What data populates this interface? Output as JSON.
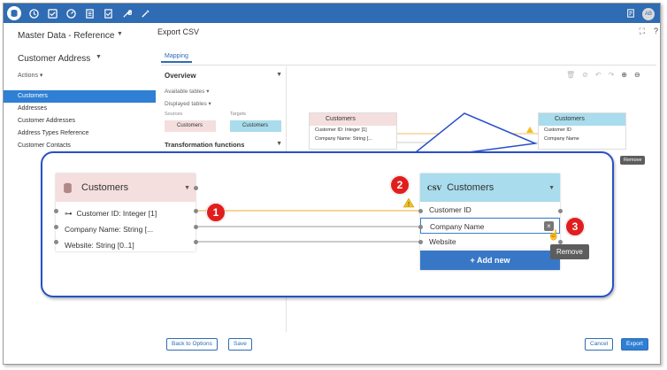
{
  "app": {
    "header_title": "Master Data - Reference",
    "entity_title": "Customer Address",
    "actions_label": "Actions",
    "page_title": "Export CSV",
    "avatar_initials": "AB"
  },
  "sidebar": {
    "items": [
      {
        "label": "Customers",
        "selected": true
      },
      {
        "label": "Addresses",
        "selected": false
      },
      {
        "label": "Customer Addresses",
        "selected": false
      },
      {
        "label": "Address Types Reference",
        "selected": false
      },
      {
        "label": "Customer Contacts",
        "selected": false
      }
    ]
  },
  "tabs": [
    {
      "label": "Mapping"
    }
  ],
  "overview": {
    "title": "Overview",
    "available_tables": "Available tables",
    "displayed_tables": "Displayed tables",
    "sources_label": "Sources",
    "targets_label": "Targets",
    "source_chip": "Customers",
    "target_chip": "Customers",
    "transformation_functions": "Transformation functions"
  },
  "diagram": {
    "source": {
      "title": "Customers",
      "rows": [
        "Customer ID: Integer [1]",
        "Company Name: String [...",
        "Website: String [0..1]"
      ]
    },
    "target": {
      "badge": "CSV",
      "title": "Customers",
      "rows": [
        "Customer ID",
        "Company Name",
        "Website"
      ],
      "add_new": "+ Add new"
    },
    "tooltip": "Remove",
    "steps": [
      "1",
      "2",
      "3"
    ]
  },
  "footer": {
    "back_label": "Back to Options",
    "save_label": "Save",
    "cancel_label": "Cancel",
    "export_label": "Export"
  },
  "colors": {
    "topbar": "#2f6cb3",
    "selected": "#2f7fd4",
    "callout_border": "#2850c8",
    "step_badge": "#e11d1d",
    "source_header": "#f4dede",
    "target_header": "#a9dcec",
    "mapping_line": "#f0a830"
  }
}
